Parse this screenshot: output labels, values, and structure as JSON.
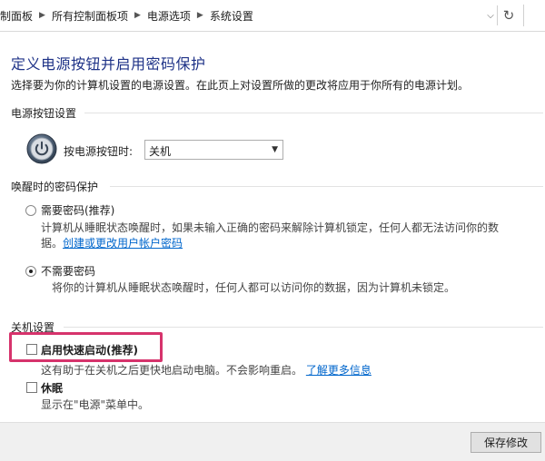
{
  "breadcrumb": [
    "制面板",
    "所有控制面板项",
    "电源选项",
    "系统设置"
  ],
  "page": {
    "title": "定义电源按钮并启用密码保护",
    "description": "选择要为你的计算机设置的电源设置。在此页上对设置所做的更改将应用于你所有的电源计划。"
  },
  "power_button": {
    "header": "电源按钮设置",
    "label": "按电源按钮时:",
    "selected": "关机"
  },
  "wake_password": {
    "header": "唤醒时的密码保护",
    "options": [
      {
        "label": "需要密码(推荐)",
        "desc_line1": "计算机从睡眠状态唤醒时，如果未输入正确的密码来解除计算机锁定，任何人都无法访问你的数",
        "desc_line2_prefix": "据。",
        "link": "创建或更改用户帐户密码",
        "checked": false
      },
      {
        "label": "不需要密码",
        "desc_line1": "将你的计算机从睡眠状态唤醒时，任何人都可以访问你的数据，因为计算机未锁定。",
        "checked": true
      }
    ]
  },
  "shutdown": {
    "header": "关机设置",
    "options": [
      {
        "label": "启用快速启动(推荐)",
        "desc": "这有助于在关机之后更快地启动电脑。不会影响重启。",
        "link": "了解更多信息",
        "checked": false
      },
      {
        "label": "休眠",
        "desc": "显示在\"电源\"菜单中。",
        "checked": false
      }
    ]
  },
  "footer": {
    "save_label": "保存修改"
  },
  "colors": {
    "title": "#1e3287",
    "link": "#0066cc",
    "highlight": "#d6336c"
  }
}
